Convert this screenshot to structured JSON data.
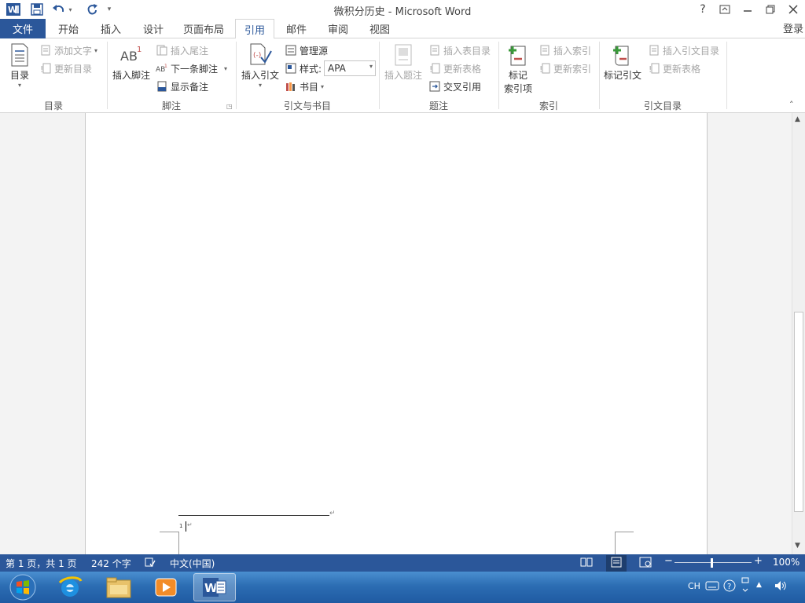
{
  "window": {
    "title": "微积分历史 - Microsoft Word",
    "help": "?",
    "login": "登录"
  },
  "tabs": {
    "file": "文件",
    "items": [
      "开始",
      "插入",
      "设计",
      "页面布局",
      "引用",
      "邮件",
      "审阅",
      "视图"
    ],
    "active": "引用"
  },
  "ribbon": {
    "toc": {
      "toc_btn": "目录",
      "add_text": "添加文字",
      "update_toc": "更新目录",
      "label": "目录"
    },
    "footnotes": {
      "insert_footnote": "插入脚注",
      "insert_endnote": "插入尾注",
      "next_footnote": "下一条脚注",
      "show_notes": "显示备注",
      "label": "脚注",
      "ab_glyph": "AB",
      "ab_sup": "1"
    },
    "citations": {
      "insert_citation": "插入引文",
      "manage_sources": "管理源",
      "style_label": "样式:",
      "style_value": "APA",
      "bibliography": "书目",
      "label": "引文与书目"
    },
    "captions": {
      "insert_caption": "插入题注",
      "insert_tof": "插入表目录",
      "update_table": "更新表格",
      "cross_ref": "交叉引用",
      "label": "题注"
    },
    "index": {
      "mark_entry_1": "标记",
      "mark_entry_2": "索引项",
      "insert_index": "插入索引",
      "update_index": "更新索引",
      "label": "索引"
    },
    "toa": {
      "mark_citation": "标记引文",
      "insert_toa": "插入引文目录",
      "update_table": "更新表格",
      "label": "引文目录"
    }
  },
  "status": {
    "page": "第 1 页，共 1 页",
    "words": "242 个字",
    "language": "中文(中国)",
    "zoom": "100%"
  },
  "tray": {
    "ime": "CH"
  },
  "colors": {
    "accent": "#2b579a",
    "page_bg": "#f3f3f3"
  }
}
